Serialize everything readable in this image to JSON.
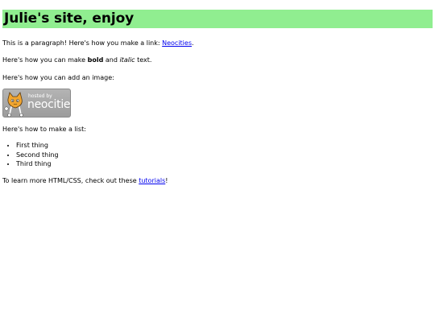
{
  "site": {
    "title": "Julie's site, enjoy"
  },
  "content": {
    "link_intro": "This is a paragraph! Here's how you make a link: ",
    "link_text": "Neocities",
    "link_end": ".",
    "format_intro": "Here's how you can make ",
    "bold_text": "bold",
    "format_middle": " and ",
    "italic_text": "italic",
    "format_end": " text.",
    "image_intro": "Here's how you can add an image:",
    "badge": {
      "small_text": "hosted by",
      "big_text": "neocities",
      "icon": "neocities-cat-icon"
    },
    "list_intro": "Here's how to make a list:",
    "list_items": [
      "First thing",
      "Second thing",
      "Third thing"
    ],
    "tutorial_intro": "To learn more HTML/CSS, check out these ",
    "tutorial_link": "tutorials",
    "tutorial_end": "!"
  },
  "colors": {
    "title_background": "#90ee90",
    "link": "#0000ee"
  }
}
